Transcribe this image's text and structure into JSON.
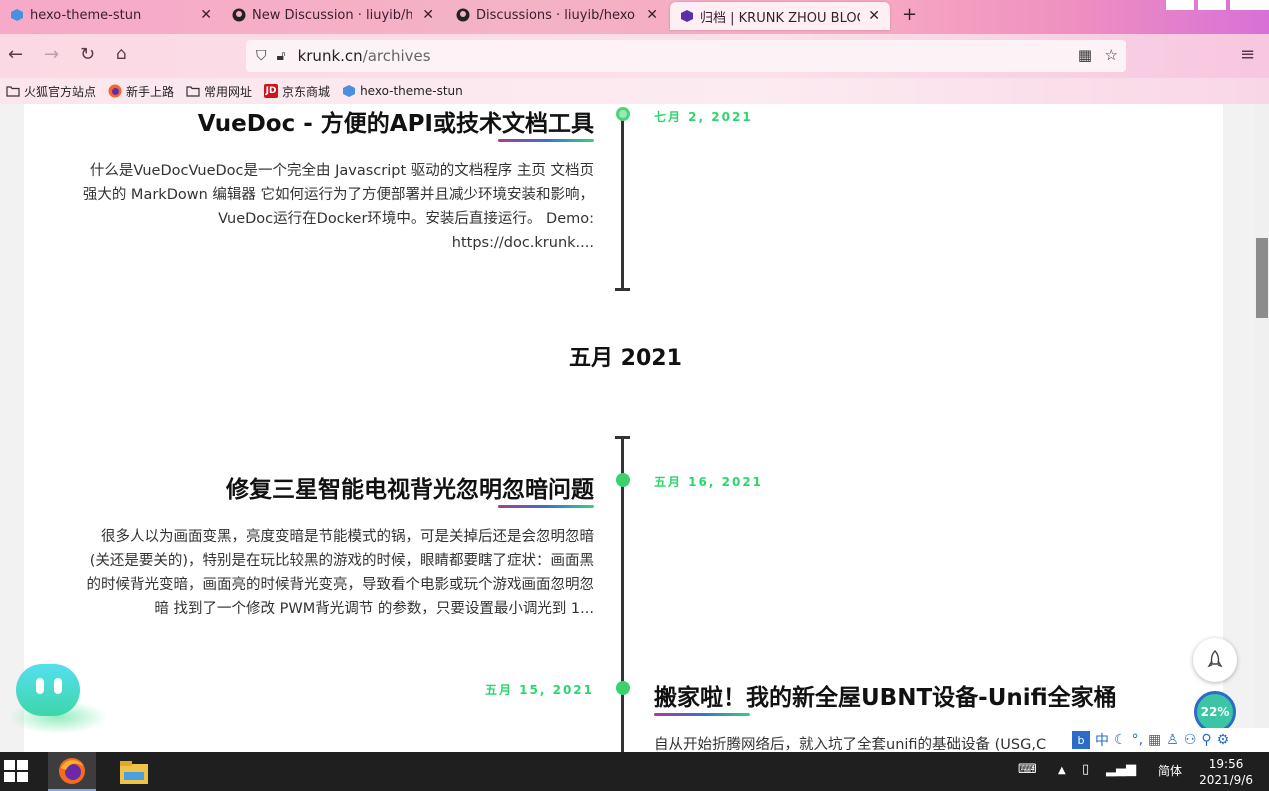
{
  "browser": {
    "tabs": [
      {
        "label": "hexo-theme-stun",
        "icon": "stun-logo-icon"
      },
      {
        "label": "New Discussion · liuyib/hexo-theme-stun",
        "icon": "github-icon"
      },
      {
        "label": "Discussions · liuyib/hexo-theme-stun",
        "icon": "github-icon"
      },
      {
        "label": "归档 | KRUNK ZHOU BLOG",
        "icon": "blog-logo-icon"
      }
    ],
    "url_host": "krunk.cn",
    "url_path": "/archives",
    "bookmarks": [
      {
        "label": "火狐官方站点",
        "icon": "folder-icon"
      },
      {
        "label": "新手上路",
        "icon": "firefox-icon"
      },
      {
        "label": "常用网址",
        "icon": "folder-icon"
      },
      {
        "label": "京东商城",
        "icon": "jd-icon"
      },
      {
        "label": "hexo-theme-stun",
        "icon": "stun-logo-icon"
      }
    ]
  },
  "archive": {
    "posts": [
      {
        "title": "VueDoc - 方便的API或技术文档工具",
        "date": "七月 2, 2021",
        "excerpt": "什么是VueDocVueDoc是一个完全由 Javascript 驱动的文档程序 主页 文档页 强大的 MarkDown 编辑器 它如何运行为了方便部署并且减少环境安装和影响，VueDoc运行在Docker环境中。安装后直接运行。 Demo: https://doc.krunk...."
      },
      {
        "title": "修复三星智能电视背光忽明忽暗问题",
        "date": "五月 16, 2021",
        "excerpt": "很多人以为画面变黑，亮度变暗是节能模式的锅，可是关掉后还是会忽明忽暗 (关还是要关的)，特别是在玩比较黑的游戏的时候，眼睛都要瞎了症状：画面黑的时候背光变暗，画面亮的时候背光变亮，导致看个电影或玩个游戏画面忽明忽暗 找到了一个修改 PWM背光调节 的参数，只要设置最小调光到 1..."
      },
      {
        "title": "搬家啦！我的新全屋UBNT设备-Unifi全家桶",
        "date": "五月 15, 2021",
        "excerpt": "自从开始折腾网络后，就入坑了全套unifi的基础设备 (USG,C"
      }
    ],
    "month_heading": "五月 2021",
    "reading_progress": "22%",
    "reading_progress_value": 22
  },
  "taskbar": {
    "ime_label": "简体",
    "time": "19:56",
    "date": "2021/9/6"
  },
  "colors": {
    "accent_green": "#2bd86b",
    "timeline": "#333333"
  }
}
